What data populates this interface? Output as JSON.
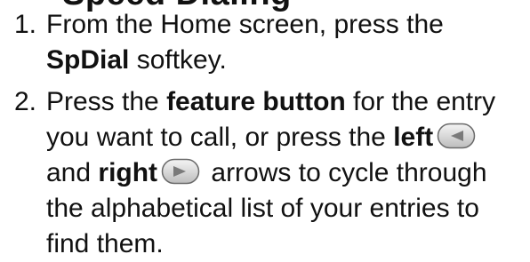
{
  "heading_partial": "Speed Dialing",
  "steps": [
    {
      "num": "1.",
      "line1": "From the Home screen, press the",
      "bold": "SpDial",
      "line2_rest": " softkey."
    },
    {
      "num": "2.",
      "pre": "Press the ",
      "bold_feature": "feature button",
      "post": " for the entry",
      "line2_pre": "you want to call, or press the ",
      "bold_left": "left",
      "line3_bold_right": "right",
      "line3_post": " arrows to cycle through",
      "line3_and": "and ",
      "line4": "the alphabetical list of your entries to",
      "line5": "find them."
    }
  ],
  "icons": {
    "left_arrow": "left-arrow-key-icon",
    "right_arrow": "right-arrow-key-icon"
  }
}
